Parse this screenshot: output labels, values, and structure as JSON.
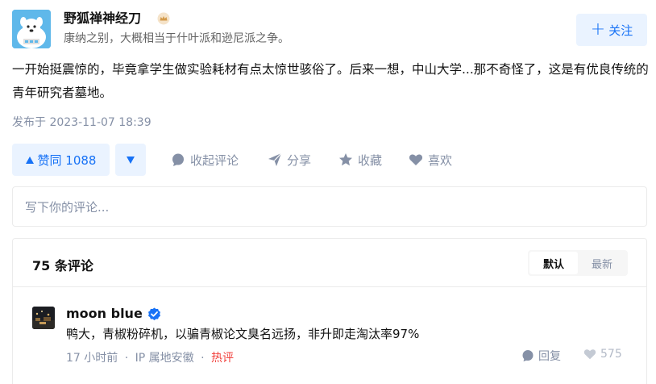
{
  "author": {
    "name": "野狐禅神经刀",
    "bio": "康纳之别，大概相当于什叶派和逊尼派之争。",
    "follow_label": "关注"
  },
  "answer": {
    "text": "一开始挺震惊的，毕竟拿学生做实验耗材有点太惊世骇俗了。后来一想，中山大学...那不奇怪了，这是有优良传统的青年研究者墓地。",
    "published": "发布于 2023-11-07 18:39"
  },
  "actions": {
    "upvote_label": "赞同 1088",
    "collapse_comments": "收起评论",
    "share": "分享",
    "favorite": "收藏",
    "like": "喜欢"
  },
  "comment_input": {
    "placeholder": "写下你的评论..."
  },
  "comments": {
    "count_label": "75 条评论",
    "sort_options": [
      "默认",
      "最新"
    ],
    "active_sort": "默认",
    "items": [
      {
        "user": "moon blue",
        "text": "鸭大，青椒粉碎机，以骗青椒论文臭名远扬，非升即走淘汰率97%",
        "time": "17 小时前",
        "separator": "·",
        "ip": "IP 属地安徽",
        "tag": "热评",
        "reply_label": "回复",
        "likes": "575"
      }
    ]
  },
  "colors": {
    "accent": "#1772f6",
    "accent_bg": "#eaf3ff",
    "muted": "#8590a6",
    "hot": "#f1403c"
  }
}
